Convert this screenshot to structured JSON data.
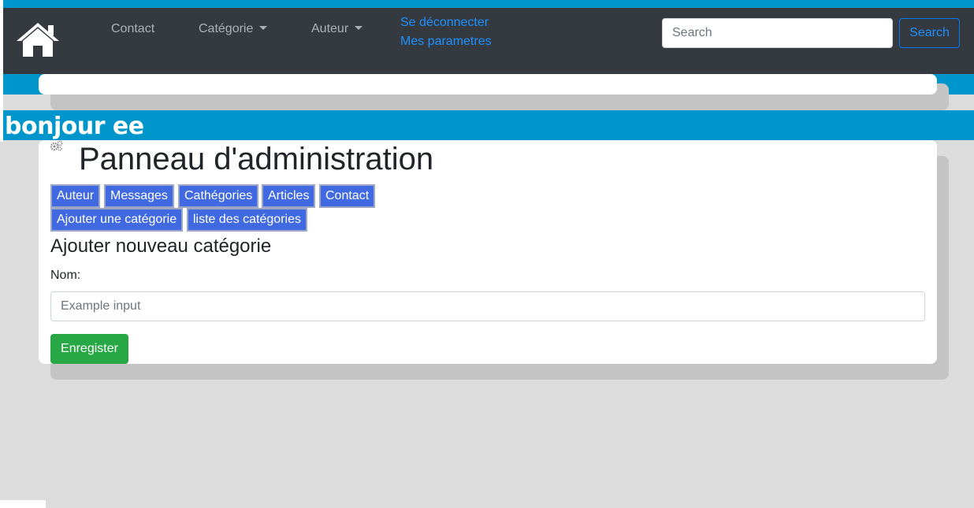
{
  "navbar": {
    "home_icon": "home-icon",
    "contact_label": "Contact",
    "category_label": "Catégorie",
    "author_label": "Auteur",
    "logout_label": "Se déconnecter",
    "settings_label": "Mes parametres",
    "search_placeholder": "Search",
    "search_button": "Search"
  },
  "greeting": "bonjour ee",
  "panel": {
    "icon": "gear-icon",
    "title": "Panneau d'administration",
    "tabs": [
      "Auteur",
      "Messages",
      "Cathégories",
      "Articles",
      "Contact"
    ],
    "subtabs": [
      "Ajouter une catégorie",
      "liste des catégories"
    ],
    "section_title": "Ajouter nouveau catégorie",
    "name_label": "Nom:",
    "name_placeholder": "Example input",
    "save_button": "Enregister"
  },
  "colors": {
    "accent_blue": "#0096cc",
    "navbar_bg": "#343a40",
    "tab_bg": "#4169e1",
    "save_green": "#28a745",
    "link_blue": "#1e90ff"
  }
}
